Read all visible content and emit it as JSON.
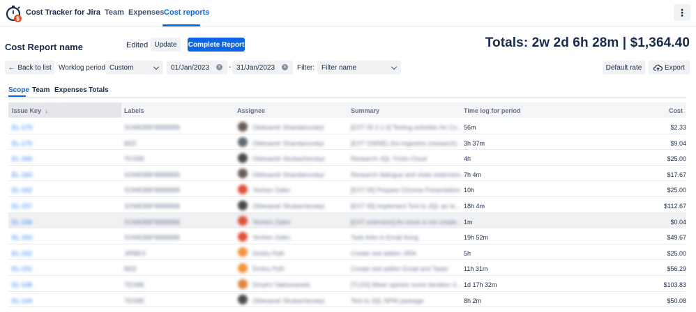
{
  "app": {
    "title": "Cost Tracker for Jira"
  },
  "nav": {
    "items": [
      {
        "label": "Team"
      },
      {
        "label": "Expenses"
      },
      {
        "label": "Cost reports"
      }
    ],
    "active": "Cost reports"
  },
  "report": {
    "name": "Cost Report name",
    "status": "Edited",
    "update_label": "Update",
    "complete_label": "Complete Report",
    "totals": "Totals: 2w 2d 6h 28m | $1,364.40"
  },
  "filters": {
    "back_label": "Back to list",
    "worklog_label": "Worklog period:",
    "period_value": "Custom",
    "date_from": "01/Jan/2023",
    "date_sep": "-",
    "date_to": "31/Jan/2023",
    "filter_label": "Filter:",
    "filter_placeholder": "Filter name",
    "default_rate_label": "Default rate",
    "export_label": "Export"
  },
  "tabs": [
    {
      "label": "Scope"
    },
    {
      "label": "Team"
    },
    {
      "label": "Expenses"
    },
    {
      "label": "Totals"
    }
  ],
  "table": {
    "headers": {
      "issue_key": "Issue Key",
      "labels": "Labels",
      "assignee": "Assignee",
      "summary": "Summary",
      "time_log": "Time log for period",
      "cost": "Cost"
    },
    "rows": [
      {
        "key": "EL-179",
        "labels": "SOMEBBFBBBBBB",
        "assignee": "Oleksandr Shandarovskyi",
        "summary": "[EXT 05 2.1.0] Testing activities for Co...",
        "time": "56m",
        "cost": "$2.33",
        "avatar": "#6b5b53"
      },
      {
        "key": "EL-175",
        "labels": "BEE",
        "assignee": "Oleksandr Shandarovskyi",
        "summary": "[EXT OWNE] Jira Ingestion (research) ...",
        "time": "3h 37m",
        "cost": "$9.04",
        "avatar": "#5e6b75"
      },
      {
        "key": "EL-164",
        "labels": "TEXBE",
        "assignee": "Oleksandr Skubachevskyi",
        "summary": "Research JQL Tricks Cloud",
        "time": "4h",
        "cost": "$25.00",
        "avatar": "#4a4a4a"
      },
      {
        "key": "EL-163",
        "labels": "SOMEBBFBBBBBB",
        "assignee": "Oleksandr Shandarovskyi",
        "summary": "Research dialogue and chats extension...",
        "time": "7h 4m",
        "cost": "$17.67",
        "avatar": "#6b5b53"
      },
      {
        "key": "EL-162",
        "labels": "SOMEBBFBBBBBB",
        "assignee": "Yevhen Zaiko",
        "summary": "[EXT 05] Prepare Chrome Presentation",
        "time": "10h",
        "cost": "$25.00",
        "avatar": "#e0523a"
      },
      {
        "key": "EL-157",
        "labels": "SOMEBBFBBBBBB",
        "assignee": "Oleksandr Skubachevskyi",
        "summary": "[EXT 05] Implement Tool to JQL as re...",
        "time": "18h 4m",
        "cost": "$112.67",
        "avatar": "#4a4a4a"
      },
      {
        "key": "EL-156",
        "labels": "SOMEBBFBBBBBB",
        "assignee": "Yevhen Zaiko",
        "summary": "[EXT extension] An issue is not create...",
        "time": "1m",
        "cost": "$0.04",
        "avatar": "#e0523a"
      },
      {
        "key": "EL-153",
        "labels": "SOMEBBFBBBBBB",
        "assignee": "Yevhen Zaiko",
        "summary": "Task links in Email fixing",
        "time": "19h 52m",
        "cost": "$49.67",
        "avatar": "#e0523a"
      },
      {
        "key": "EL-152",
        "labels": "JIRBEX",
        "assignee": "Dmitry Pylh",
        "summary": "Create rest addon JIRA",
        "time": "5h",
        "cost": "$25.00",
        "avatar": "#f0943a"
      },
      {
        "key": "EL-151",
        "labels": "BEE",
        "assignee": "Dmitry Pylh",
        "summary": "Create rest addon Email and Tasks",
        "time": "11h 31m",
        "cost": "$56.29",
        "avatar": "#f0943a"
      },
      {
        "key": "EL-148",
        "labels": "TEXBE",
        "assignee": "Dmytro Vakhovanets",
        "summary": "[TLDS] Mean opinion score iteration 4...",
        "time": "1d 17h 32m",
        "cost": "$103.83",
        "avatar": "#e0853a"
      },
      {
        "key": "EL-144",
        "labels": "TEXBE",
        "assignee": "Oleksandr Skubachevskyi",
        "summary": "Test to JQL NPM package",
        "time": "8h 2m",
        "cost": "$50.08",
        "avatar": "#4a4a4a"
      }
    ]
  },
  "colors": {
    "brand": "#0c66e4",
    "link": "#1d7afc",
    "header_bg": "#f4f5f7",
    "highlight_row": "#f0f1f3"
  },
  "icons": {
    "logo": "stopwatch-dollar-icon",
    "back": "arrow-left-icon",
    "export": "cloud-upload-icon",
    "menu": "kebab-menu-icon",
    "sort": "arrow-down-icon"
  }
}
